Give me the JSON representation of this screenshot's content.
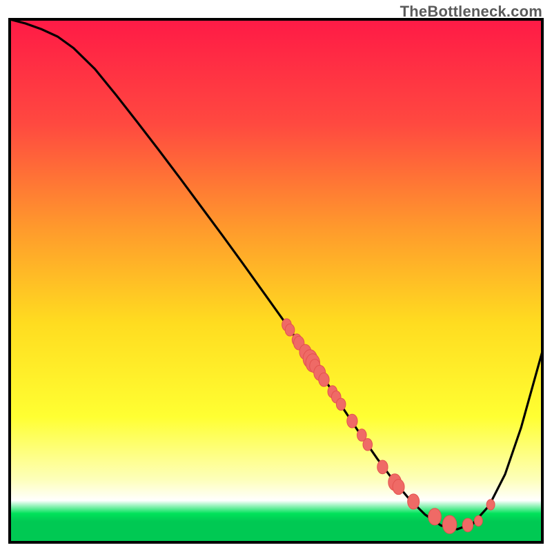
{
  "watermark": "TheBottleneck.com",
  "colors": {
    "gradient_stops": [
      {
        "offset": 0.0,
        "color": "#ff1a46"
      },
      {
        "offset": 0.2,
        "color": "#ff4940"
      },
      {
        "offset": 0.4,
        "color": "#ff9a2c"
      },
      {
        "offset": 0.58,
        "color": "#ffdc20"
      },
      {
        "offset": 0.76,
        "color": "#ffff32"
      },
      {
        "offset": 0.88,
        "color": "#fdffba"
      },
      {
        "offset": 0.92,
        "color": "#ffffff"
      },
      {
        "offset": 0.945,
        "color": "#00e25a"
      },
      {
        "offset": 0.96,
        "color": "#00c953"
      }
    ],
    "frame": "#000000",
    "curve": "#000000",
    "dot_fill": "#ef6a66",
    "dot_stroke": "#e3524e",
    "background": "#ffffff"
  },
  "chart_data": {
    "type": "line",
    "title": "",
    "xlabel": "",
    "ylabel": "",
    "xlim": [
      0,
      100
    ],
    "ylim": [
      0,
      100
    ],
    "grid": false,
    "x": [
      0,
      3,
      6,
      9,
      12,
      16,
      20,
      24,
      28,
      32,
      36,
      40,
      44,
      48,
      52,
      56,
      60,
      63,
      66,
      69,
      72,
      75,
      78,
      81,
      84,
      87,
      90,
      93,
      96,
      100
    ],
    "values": [
      100,
      99.2,
      98.1,
      96.7,
      94.5,
      90.5,
      85.5,
      80.3,
      75.0,
      69.6,
      64.1,
      58.6,
      53.0,
      47.3,
      41.6,
      35.7,
      29.8,
      25.0,
      20.4,
      16.0,
      11.9,
      8.3,
      5.3,
      3.2,
      2.5,
      3.6,
      7.0,
      13.0,
      21.9,
      36.5
    ],
    "markers": {
      "x": [
        52.0,
        52.6,
        53.9,
        54.3,
        55.5,
        56.4,
        56.9,
        57.3,
        58.2,
        59.0,
        60.6,
        61.3,
        62.2,
        64.3,
        66.1,
        67.2,
        70.0,
        72.3,
        73.0,
        75.8,
        79.8,
        82.6,
        86.0,
        88.0,
        90.3
      ],
      "y": [
        41.6,
        40.6,
        38.7,
        38.1,
        36.4,
        35.1,
        34.3,
        33.7,
        32.4,
        31.1,
        28.8,
        27.8,
        26.4,
        23.2,
        20.5,
        18.7,
        14.4,
        11.5,
        10.6,
        7.8,
        4.9,
        3.4,
        3.3,
        4.1,
        7.2
      ],
      "r": [
        8,
        8,
        8,
        9,
        10,
        12,
        12,
        9,
        10,
        9,
        8,
        8,
        8,
        9,
        8,
        8,
        9,
        11,
        10,
        10,
        11,
        12,
        9,
        7,
        7
      ]
    }
  }
}
